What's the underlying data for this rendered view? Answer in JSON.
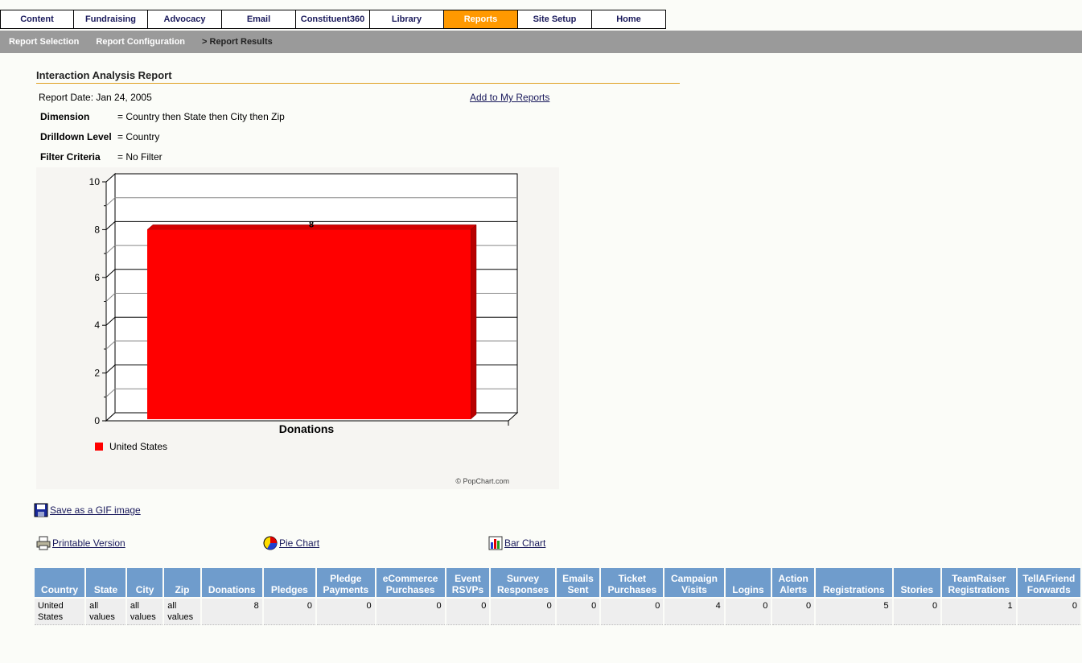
{
  "tabs": [
    "Content",
    "Fundraising",
    "Advocacy",
    "Email",
    "Constituent360",
    "Library",
    "Reports",
    "Site Setup",
    "Home"
  ],
  "active_tab": "Reports",
  "subnav": {
    "report_selection": "Report Selection",
    "report_configuration": "Report Configuration",
    "report_results": "> Report Results"
  },
  "report": {
    "title": "Interaction Analysis Report",
    "date": "Report Date: Jan 24, 2005",
    "add_link": "Add to My Reports",
    "dimension_label": "Dimension",
    "dimension_value": "= Country then State then City then Zip",
    "drilldown_label": "Drilldown Level",
    "drilldown_value": "= Country",
    "filter_label": "Filter Criteria",
    "filter_value": "= No Filter"
  },
  "chart_data": {
    "type": "bar",
    "categories": [
      "Donations"
    ],
    "series": [
      {
        "name": "United States",
        "values": [
          8
        ],
        "color": "#ff0000"
      }
    ],
    "y_ticks": [
      "0",
      "2",
      "4",
      "6",
      "8",
      "10"
    ],
    "ylim": [
      0,
      10
    ],
    "data_label": "8",
    "legend_position": "bottom-left",
    "credit": "© PopChart.com"
  },
  "links": {
    "save_gif": "Save as a GIF image",
    "printable": "Printable Version",
    "pie": "Pie Chart",
    "bar": "Bar Chart"
  },
  "table": {
    "headers": [
      "Country",
      "State",
      "City",
      "Zip",
      "Donations",
      "Pledges",
      "Pledge Payments",
      "eCommerce Purchases",
      "Event RSVPs",
      "Survey Responses",
      "Emails Sent",
      "Ticket Purchases",
      "Campaign Visits",
      "Logins",
      "Action Alerts",
      "Registrations",
      "Stories",
      "TeamRaiser Registrations",
      "TellAFriend Forwards"
    ],
    "row": [
      "United States",
      "all values",
      "all values",
      "all values",
      "8",
      "0",
      "0",
      "0",
      "0",
      "0",
      "0",
      "0",
      "4",
      "0",
      "0",
      "5",
      "0",
      "1",
      "0"
    ]
  }
}
